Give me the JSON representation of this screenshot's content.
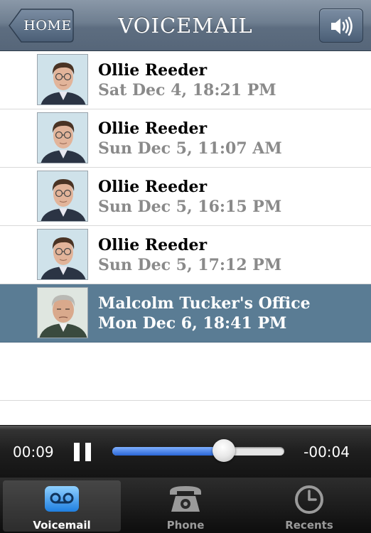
{
  "navbar": {
    "back_label": "HOME",
    "title": "VOICEMAIL",
    "speaker_icon": "speaker-volume-icon"
  },
  "voicemails": [
    {
      "name": "Ollie Reeder",
      "date": "Sat Dec 4, 18:21 PM",
      "selected": false
    },
    {
      "name": "Ollie Reeder",
      "date": "Sun Dec 5, 11:07 AM",
      "selected": false
    },
    {
      "name": "Ollie Reeder",
      "date": "Sun Dec 5, 16:15 PM",
      "selected": false
    },
    {
      "name": "Ollie Reeder",
      "date": "Sun Dec 5, 17:12 PM",
      "selected": false
    },
    {
      "name": "Malcolm Tucker's Office",
      "date": "Mon Dec 6, 18:41 PM",
      "selected": true
    }
  ],
  "player": {
    "elapsed": "00:09",
    "remaining": "-00:04",
    "progress": 0.65,
    "state": "playing"
  },
  "tabs": [
    {
      "label": "Voicemail",
      "icon": "voicemail-icon",
      "active": true
    },
    {
      "label": "Phone",
      "icon": "telephone-icon",
      "active": false
    },
    {
      "label": "Recents",
      "icon": "clock-icon",
      "active": false
    }
  ],
  "colors": {
    "selected_row": "#5a7c94",
    "slider_fill": "#2a66d6",
    "date_text": "#8a8a8a"
  }
}
